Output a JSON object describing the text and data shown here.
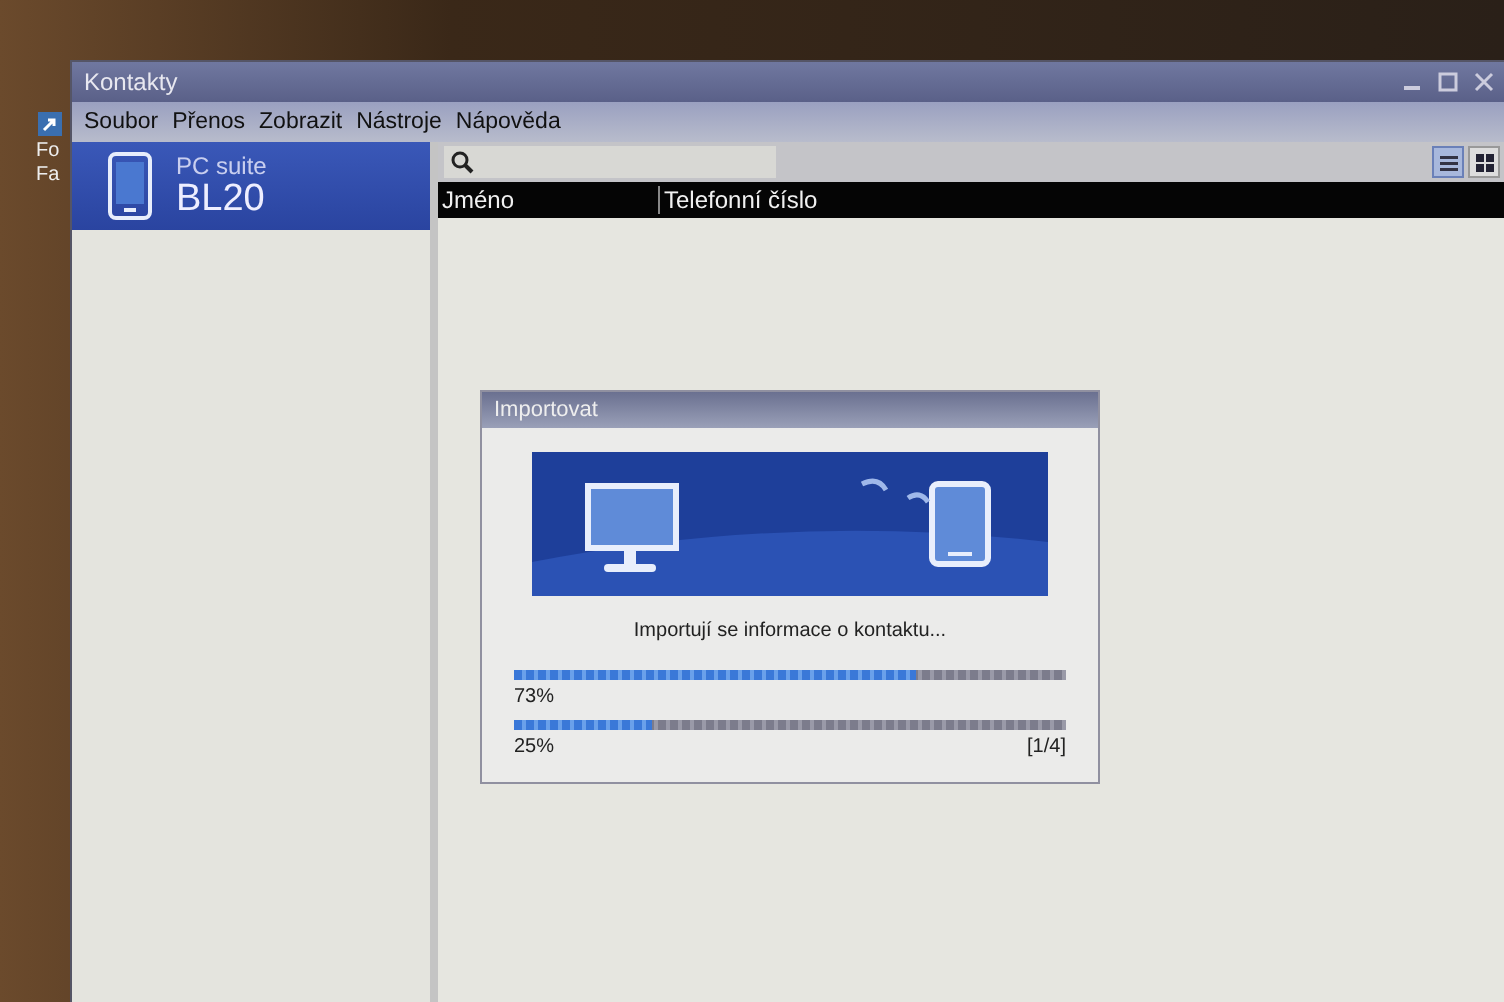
{
  "desktop_icon": {
    "label_lines": [
      "Fo",
      "Fa"
    ]
  },
  "window": {
    "title": "Kontakty"
  },
  "menu": [
    "Soubor",
    "Přenos",
    "Zobrazit",
    "Nástroje",
    "Nápověda"
  ],
  "sidebar": {
    "device": {
      "subtitle": "PC suite",
      "name": "BL20",
      "selected": true
    }
  },
  "toolbar": {
    "view_buttons": [
      {
        "kind": "list",
        "selected": true
      },
      {
        "kind": "grid",
        "selected": false
      }
    ]
  },
  "table": {
    "columns": [
      "Jméno",
      "Telefonní číslo"
    ]
  },
  "dialog": {
    "title": "Importovat",
    "message": "Importují se informace o kontaktu...",
    "progress": [
      {
        "level": 0.73,
        "reading": "73%"
      },
      {
        "level": 0.25,
        "reading": "25%",
        "counter": "[1/4]"
      }
    ]
  }
}
